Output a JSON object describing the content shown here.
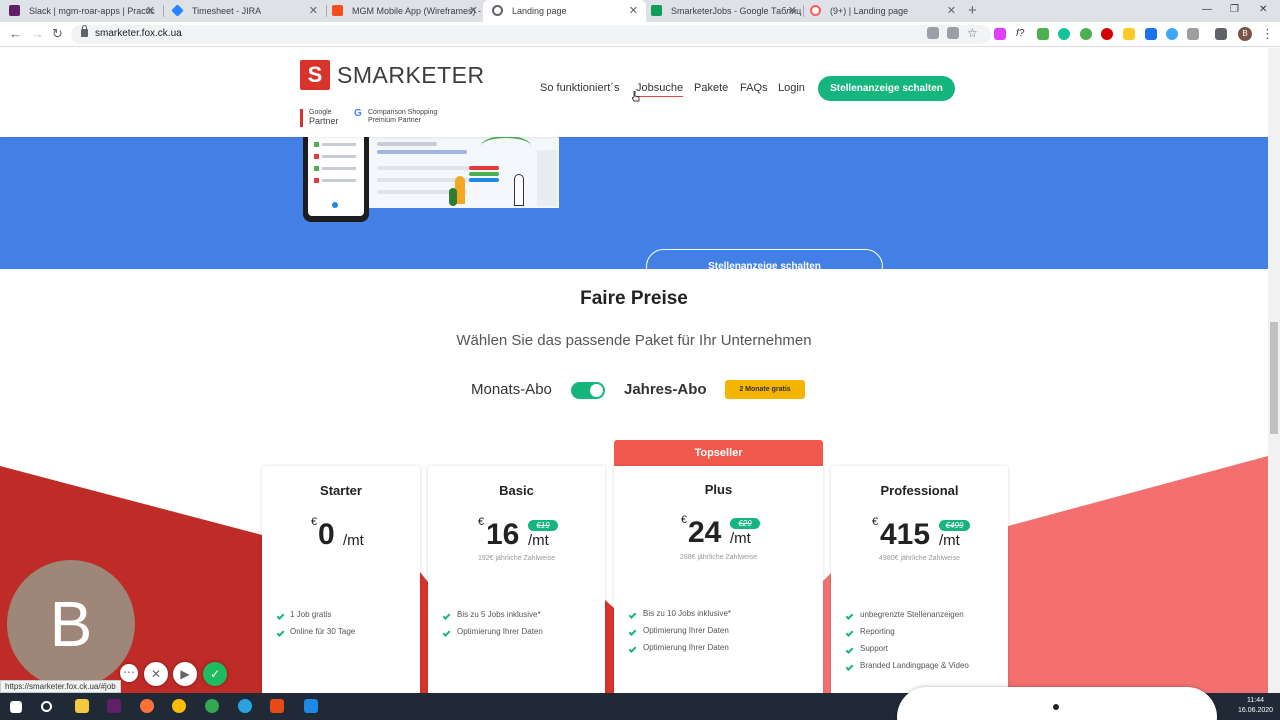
{
  "browser": {
    "tabs": [
      {
        "title": "Slack | mgm-roar-apps | Practic",
        "fav_color": "#611f69"
      },
      {
        "title": "Timesheet - JIRA",
        "fav_color": "#2684ff"
      },
      {
        "title": "MGM Mobile App (Wireframes) -",
        "fav_color": "#f24e1e"
      },
      {
        "title": "Landing page",
        "fav_color": "#5f6368"
      },
      {
        "title": "SmarketerJobs - Google Таблиц",
        "fav_color": "#0f9d58"
      },
      {
        "title": "(9+) | Landing page",
        "fav_color": "#ff5b5b"
      }
    ],
    "new_tab": "+",
    "url": "smarketer.fox.ck.ua",
    "profile_initial": "B",
    "status_url": "https://smarketer.fox.ck.ua/#job"
  },
  "site": {
    "logo_text": "SMARKETER",
    "logo_mark": "S",
    "partner_google_top": "Google",
    "partner_google_bottom": "Partner",
    "partner_css_top": "Comparison Shopping",
    "partner_css_bottom": "Premium Partner",
    "nav": [
      "So funktioniert´s",
      "Jobsuche",
      "Pakete",
      "FAQs",
      "Login"
    ],
    "cta": "Stellenanzeige schalten",
    "hero_cta": "Stellenanzeige schalten"
  },
  "pricing": {
    "title": "Faire Preise",
    "subtitle": "Wählen Sie das passende Paket für Ihr Unternehmen",
    "toggle_left": "Monats-Abo",
    "toggle_right": "Jahres-Abo",
    "toggle_on": true,
    "badge": "2 Monate gratis",
    "topseller": "Topseller",
    "currency": "€",
    "per": "/mt",
    "plans": [
      {
        "name": "Starter",
        "price": "0",
        "old": "",
        "yearly": "",
        "features": [
          "1 Job gratis",
          "Online für 30 Tage"
        ]
      },
      {
        "name": "Basic",
        "price": "16",
        "old": "€19",
        "yearly": "192€ jährliche Zahlweise",
        "features": [
          "Bis zu 5 Jobs inklusive*",
          "Optimierung Ihrer Daten"
        ]
      },
      {
        "name": "Plus",
        "price": "24",
        "old": "€29",
        "yearly": "288€ jährliche Zahlweise",
        "features": [
          "Bis zu 10 Jobs inklusive*",
          "Optimierung Ihrer Daten",
          "Optimierung Ihrer Daten"
        ]
      },
      {
        "name": "Professional",
        "price": "415",
        "old": "€499",
        "yearly": "4980€ jährliche Zahlweise",
        "features": [
          "unbegrenzte Stellenanzeigen",
          "Reporting",
          "Support",
          "Branded Landingpage & Video"
        ]
      }
    ]
  },
  "overlay": {
    "avatar_initial": "B",
    "clock_time": "11:44",
    "clock_date": "16.06.2020"
  },
  "colors": {
    "accent_green": "#14b67d",
    "hero_blue": "#4380e6",
    "brand_red": "#d9342b",
    "topseller_red": "#f0594c"
  }
}
